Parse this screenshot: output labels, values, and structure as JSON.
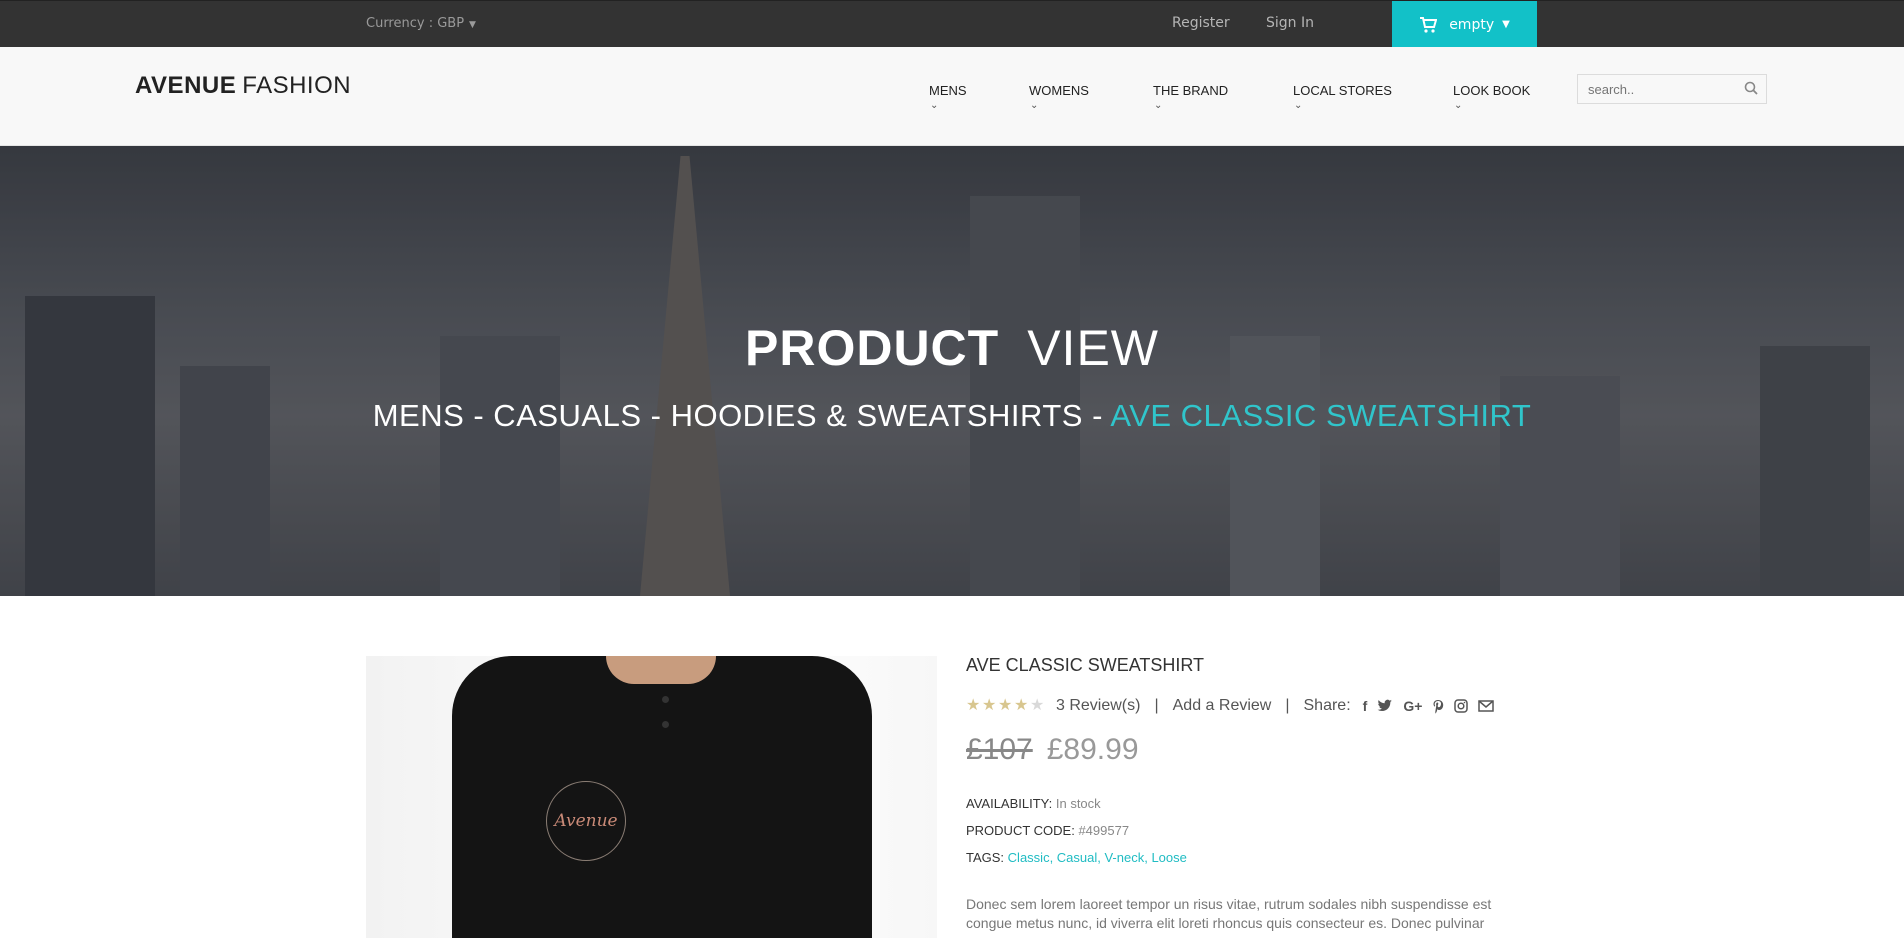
{
  "topbar": {
    "currency": "Currency : GBP",
    "register": "Register",
    "sign_in": "Sign In",
    "cart_label": "empty"
  },
  "header": {
    "logo_bold": "AVENUE",
    "logo_light": "FASHION",
    "nav": [
      "MENS",
      "WOMENS",
      "THE BRAND",
      "LOCAL STORES",
      "LOOK BOOK"
    ],
    "search_placeholder": "search.."
  },
  "hero": {
    "title_bold": "PRODUCT",
    "title_light": "VIEW",
    "breadcrumb": "MENS - CASUALS - HOODIES & SWEATSHIRTS - ",
    "breadcrumb_current": "AVE CLASSIC SWEATSHIRT"
  },
  "product": {
    "image_badge": "Avenue",
    "name": "AVE CLASSIC SWEATSHIRT",
    "rating": 4,
    "rating_max": 5,
    "reviews": "3 Review(s)",
    "add_review": "Add a Review",
    "share_label": "Share:",
    "share_icons": [
      "facebook-icon",
      "twitter-icon",
      "google-plus-icon",
      "pinterest-icon",
      "instagram-icon",
      "email-icon"
    ],
    "old_price": "£107",
    "price": "£89.99",
    "availability_label": "AVAILABILITY:",
    "availability": "In stock",
    "code_label": "PRODUCT CODE:",
    "code": "#499577",
    "tags_label": "TAGS:",
    "tags": "Classic, Casual, V-neck, Loose",
    "description": "Donec sem lorem laoreet tempor un risus vitae, rutrum sodales nibh suspendisse est congue metus nunc, id viverra elit loreti rhoncus quis consecteur es. Donec pulvinar"
  },
  "colors": {
    "accent": "#12c1c8",
    "topbar": "#333333"
  }
}
